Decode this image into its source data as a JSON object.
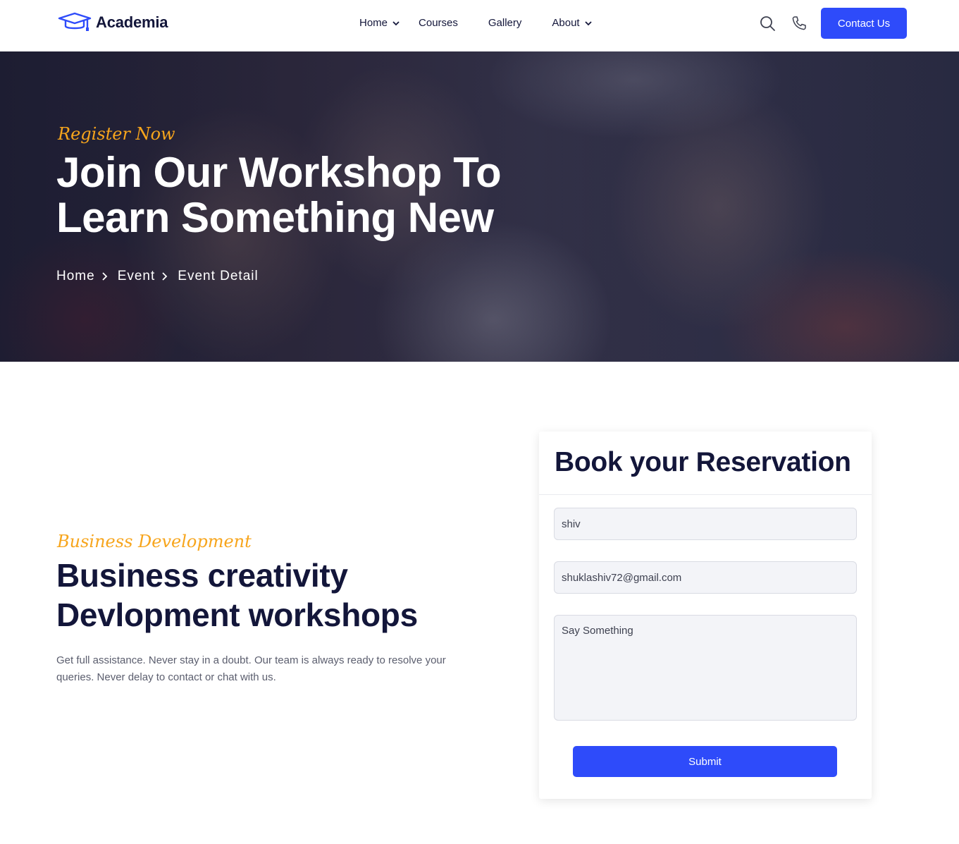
{
  "brand": {
    "name": "Academia",
    "icon": "graduation-cap-icon",
    "accent_color": "#2e4bfa",
    "highlight_color": "#f7a51c"
  },
  "nav": {
    "items": [
      {
        "label": "Home",
        "has_dropdown": true
      },
      {
        "label": "Courses",
        "has_dropdown": false
      },
      {
        "label": "Gallery",
        "has_dropdown": false
      },
      {
        "label": "About",
        "has_dropdown": true
      }
    ],
    "search_icon": "search-icon",
    "phone_icon": "phone-icon",
    "contact_label": "Contact Us"
  },
  "hero": {
    "tagline": "Register Now",
    "title": "Join Our Workshop To Learn Something New",
    "breadcrumb": [
      "Home",
      "Event",
      "Event Detail"
    ]
  },
  "section": {
    "tagline": "Business Development",
    "title": "Business creativity Devlopment workshops",
    "description": "Get full assistance. Never stay in a doubt. Our team is always ready to resolve your queries. Never delay to contact or chat with us."
  },
  "reservation": {
    "title": "Book your Reservation",
    "name_value": "shiv",
    "email_value": "shuklashiv72@gmail.com",
    "message_placeholder": "Say Something",
    "submit_label": "Submit"
  }
}
